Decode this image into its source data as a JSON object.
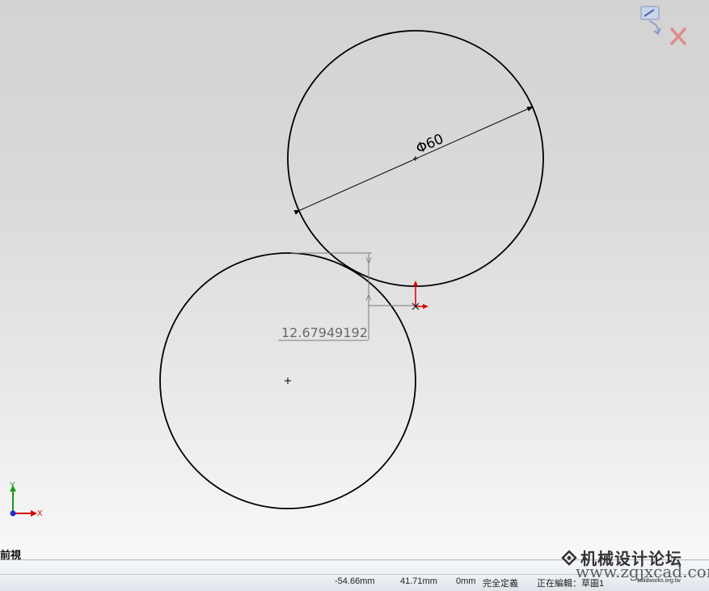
{
  "sketch": {
    "diameter_dimension": "Φ60",
    "distance_dimension": "12.67949192"
  },
  "triad": {
    "y_label": "Y",
    "x_label": "X"
  },
  "view": {
    "label": "前視"
  },
  "statusbar": {
    "x_coord": "-54.66mm",
    "y_coord": "41.71mm",
    "z_coord": "0mm",
    "definition_state": "完全定義",
    "editing": "正在編輯：草圖1"
  },
  "watermark": {
    "title": "机械设计论坛",
    "url": "www.zgjxcad.com",
    "small": "solidworks.org.tw"
  },
  "colors": {
    "sketch_line": "#000000",
    "dim_line": "#707070",
    "origin_red": "#d40000",
    "triad_x": "#d20000",
    "triad_y": "#1a9a1a",
    "triad_z": "#1a2fd0"
  }
}
